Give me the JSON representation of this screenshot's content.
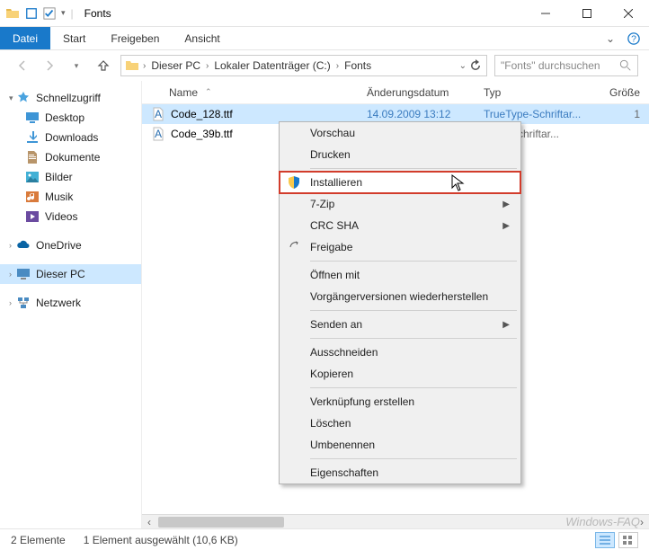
{
  "window": {
    "title": "Fonts"
  },
  "ribbon": {
    "file": "Datei",
    "tabs": [
      "Start",
      "Freigeben",
      "Ansicht"
    ]
  },
  "breadcrumb": {
    "items": [
      "Dieser PC",
      "Lokaler Datenträger (C:)",
      "Fonts"
    ]
  },
  "search": {
    "placeholder": "\"Fonts\" durchsuchen"
  },
  "nav": {
    "quick": {
      "label": "Schnellzugriff",
      "items": [
        "Desktop",
        "Downloads",
        "Dokumente",
        "Bilder",
        "Musik",
        "Videos"
      ]
    },
    "onedrive": "OneDrive",
    "thispc": "Dieser PC",
    "network": "Netzwerk"
  },
  "columns": {
    "name": "Name",
    "date": "Änderungsdatum",
    "type": "Typ",
    "size": "Größe"
  },
  "files": [
    {
      "name": "Code_128.ttf",
      "date": "14.09.2009 13:12",
      "type": "TrueType-Schriftar...",
      "size": "1",
      "selected": true
    },
    {
      "name": "Code_39b.ttf",
      "date": "",
      "type": "Type-Schriftar...",
      "size": "",
      "selected": false
    }
  ],
  "context_menu": {
    "items": [
      {
        "label": "Vorschau"
      },
      {
        "label": "Drucken"
      },
      {
        "sep": true
      },
      {
        "label": "Installieren",
        "icon": "shield",
        "highlight": true
      },
      {
        "label": "7-Zip",
        "sub": true
      },
      {
        "label": "CRC SHA",
        "sub": true
      },
      {
        "label": "Freigabe",
        "icon": "share"
      },
      {
        "sep": true
      },
      {
        "label": "Öffnen mit"
      },
      {
        "label": "Vorgängerversionen wiederherstellen"
      },
      {
        "sep": true
      },
      {
        "label": "Senden an",
        "sub": true
      },
      {
        "sep": true
      },
      {
        "label": "Ausschneiden"
      },
      {
        "label": "Kopieren"
      },
      {
        "sep": true
      },
      {
        "label": "Verknüpfung erstellen"
      },
      {
        "label": "Löschen"
      },
      {
        "label": "Umbenennen"
      },
      {
        "sep": true
      },
      {
        "label": "Eigenschaften"
      }
    ]
  },
  "status": {
    "count": "2 Elemente",
    "selection": "1 Element ausgewählt (10,6 KB)"
  },
  "watermark": "Windows-FAQ"
}
